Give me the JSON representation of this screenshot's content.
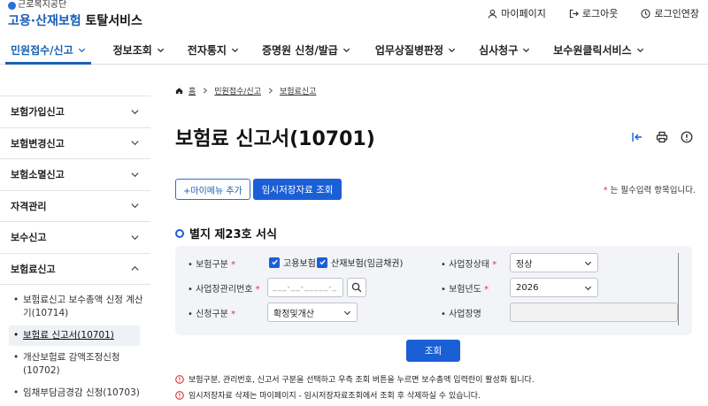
{
  "header": {
    "org": "근로복지공단",
    "service_blue": "고용·산재보험",
    "service_dark": "토탈서비스",
    "util": [
      {
        "label": "마이페이지",
        "icon": "user-icon"
      },
      {
        "label": "로그아웃",
        "icon": "logout-icon"
      },
      {
        "label": "로그인연장",
        "icon": "clock-icon"
      }
    ]
  },
  "gnb": [
    {
      "label": "민원접수/신고",
      "active": true
    },
    {
      "label": "정보조회"
    },
    {
      "label": "전자통지"
    },
    {
      "label": "증명원 신청/발급"
    },
    {
      "label": "업무상질병판정"
    },
    {
      "label": "심사청구"
    },
    {
      "label": "보수원클릭서비스"
    }
  ],
  "sidebar": {
    "items": [
      {
        "label": "보험가입신고"
      },
      {
        "label": "보험변경신고"
      },
      {
        "label": "보험소멸신고"
      },
      {
        "label": "자격관리"
      },
      {
        "label": "보수신고"
      },
      {
        "label": "보험료신고"
      }
    ],
    "sub": [
      {
        "label": "보험료신고 보수총액 신정 계산기(10714)"
      },
      {
        "label": "보험료 신고서(10701)"
      },
      {
        "label": "개산보험료 감액조정신청(10702)"
      },
      {
        "label": "임채부담금경감 신청(10703)"
      }
    ]
  },
  "breadcrumb": {
    "home": "홈",
    "level1": "민원접수/신고",
    "level2": "보험료신고"
  },
  "page": {
    "title": "보험료 신고서(10701)",
    "add_menu": "+마이메뉴 추가",
    "temp_query": "임시저장자료 조회",
    "required_note": "는 필수입력 항목입니다.",
    "required_star": "*",
    "section_title": "별지 제23호 서식"
  },
  "form": {
    "insurance_type_label": "보험구분",
    "employment_label": "고용보험",
    "industrial_label": "산재보험(임금채권)",
    "biz_status_label": "사업장상태",
    "biz_status_value": "정상",
    "biz_no_label": "사업장관리번호",
    "biz_no_placeholder": "___-__-_____-_",
    "ins_year_label": "보험년도",
    "ins_year_value": "2026",
    "apply_type_label": "신청구분",
    "apply_type_value": "확정및개산",
    "biz_name_label": "사업장명",
    "star": "*"
  },
  "query_button": "조회",
  "notes": [
    "보험구분, 관리번호, 신고서 구분을 선택하고 우측 조회 버튼을 누르면 보수총액 입력란이 활성화 됩니다.",
    "임시저장자료 삭제는 마이페이지 - 임시저장자료조회에서 조회 후 삭제하실 수 있습니다."
  ],
  "colors": {
    "accent": "#1a5fd6",
    "required": "#d33333"
  }
}
